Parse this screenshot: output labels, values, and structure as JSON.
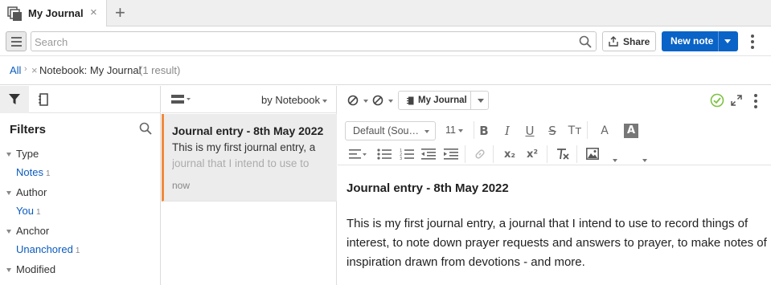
{
  "tab": {
    "title": "My Journal",
    "close_glyph": "×",
    "add_glyph": "+"
  },
  "toolbar": {
    "search_placeholder": "Search",
    "share_label": "Share",
    "new_note_label": "New note",
    "brand_color": "#0a63c6"
  },
  "breadcrumb": {
    "all": "All",
    "separator": "›",
    "remove_glyph": "×",
    "notebook": "Notebook: My Journal",
    "count": "(1 result)"
  },
  "filters": {
    "title": "Filters",
    "groups": [
      {
        "label": "Type",
        "item": "Notes",
        "count": "1"
      },
      {
        "label": "Author",
        "item": "You",
        "count": "1"
      },
      {
        "label": "Anchor",
        "item": "Unanchored",
        "count": "1"
      },
      {
        "label": "Modified"
      }
    ]
  },
  "note_list": {
    "sort_label": "by Notebook",
    "notes": [
      {
        "title": "Journal entry - 8th May 2022",
        "snippet": "This is my first journal entry, a journal that I intend to use to",
        "time": "now",
        "accent_color": "#f08a3c"
      }
    ]
  },
  "editor": {
    "notebook_chip": "My Journal",
    "paragraph_style": "Default (Sou…",
    "font_size": "11",
    "saved_color": "#7cc242",
    "doc_title": "Journal entry - 8th May 2022",
    "doc_body": "This is my first journal entry, a journal that I intend to use to record things of interest, to note down prayer requests and answers to prayer, to make notes of inspiration drawn from devotions - and more."
  }
}
